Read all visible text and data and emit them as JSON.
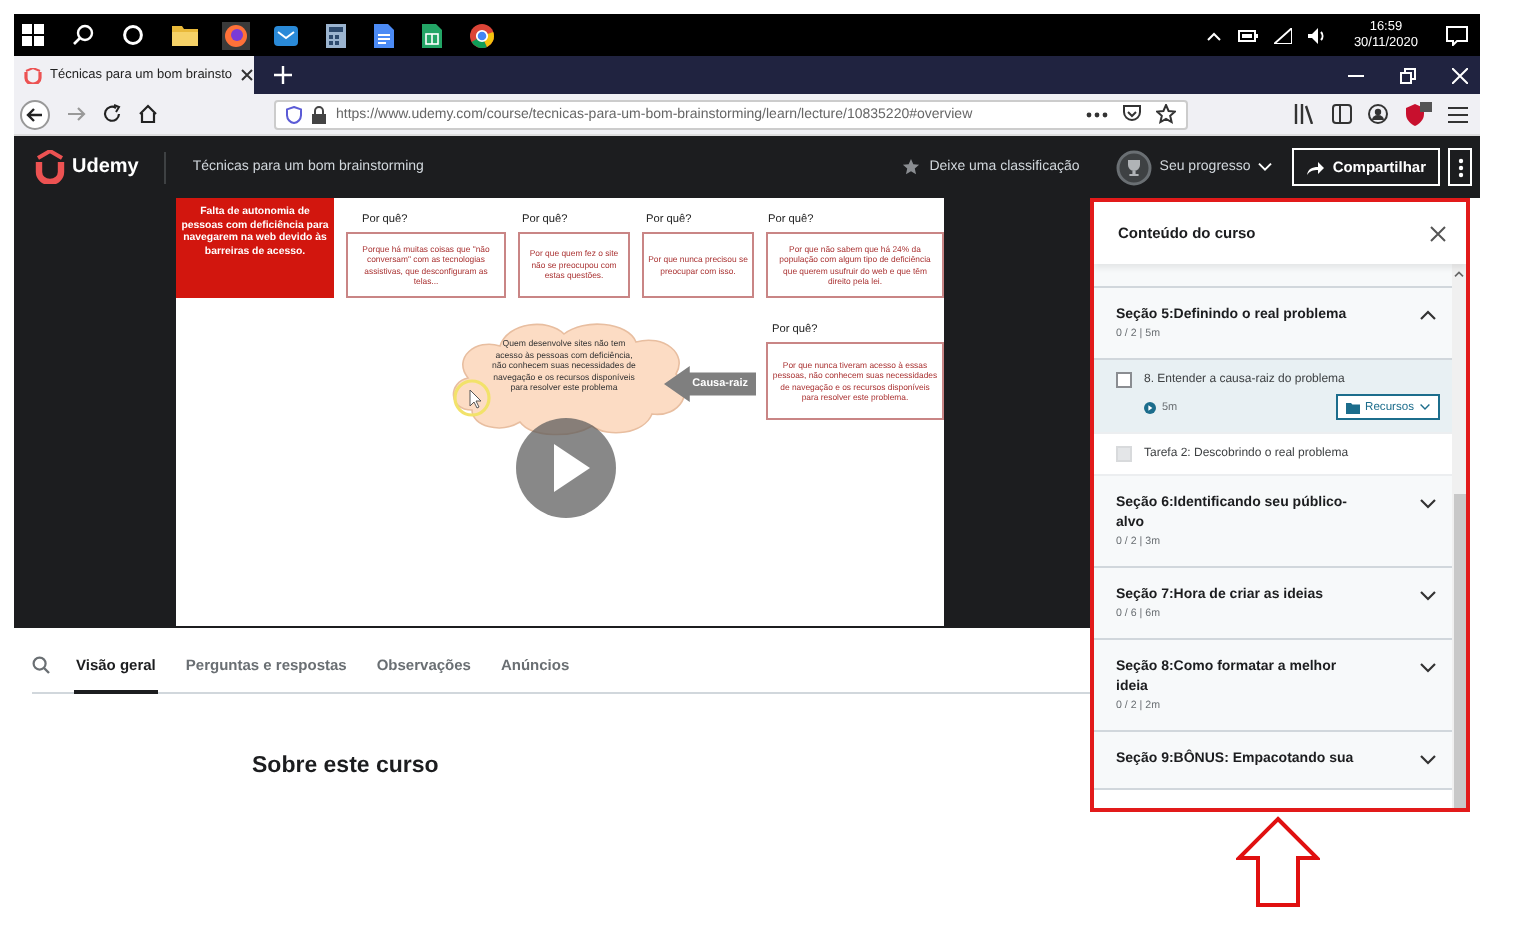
{
  "taskbar": {
    "time": "16:59",
    "date": "30/11/2020"
  },
  "browser": {
    "tab_title": "Técnicas para um bom brainsto",
    "url": "https://www.udemy.com/course/tecnicas-para-um-bom-brainstorming/learn/lecture/10835220#overview"
  },
  "header": {
    "logo": "Udemy",
    "course_title": "Técnicas para um bom brainstorming",
    "rate": "Deixe uma classificação",
    "progress": "Seu progresso",
    "share": "Compartilhar"
  },
  "slide": {
    "problem": "Falta de autonomia de pessoas com deficiência para navegarem na web devido às barreiras de acesso.",
    "whys": [
      {
        "label": "Por quê?",
        "text": "Porque há muitas coisas que \"não conversam\" com as tecnologias assistivas, que desconfiguram as telas..."
      },
      {
        "label": "Por quê?",
        "text": "Por que quem fez o site não se preocupou com estas questões."
      },
      {
        "label": "Por quê?",
        "text": "Por que nunca precisou se preocupar com isso."
      },
      {
        "label": "Por quê?",
        "text": "Por que não sabem que há 24% da população com algum tipo de deficiência que querem usufruir do web e que têm direito pela lei."
      },
      {
        "label": "Por quê?",
        "text": "Por que nunca tiveram acesso à essas pessoas, não conhecem suas necessidades de navegação e os recursos disponíveis para resolver este problema."
      }
    ],
    "root_label": "Causa-raiz",
    "root_cause": "Quem desenvolve sites não tem acesso às pessoas com deficiência, não conhecem suas necessidades de navegação e os recursos disponíveis para resolver este problema"
  },
  "sidebar": {
    "title": "Conteúdo do curso",
    "sections": [
      {
        "title": "Seção 5:Definindo o real problema",
        "meta": "0 / 2 | 5m",
        "expanded": true,
        "items": [
          {
            "kind": "lecture",
            "title": "8. Entender a causa-raiz do problema",
            "duration": "5m",
            "resources": "Recursos",
            "selected": true,
            "checked": false
          },
          {
            "kind": "task",
            "title": "Tarefa 2: Descobrindo o real problema",
            "selected": false,
            "checked": false
          }
        ]
      },
      {
        "title": "Seção 6:Identificando seu público-alvo",
        "meta": "0 / 2 | 3m",
        "expanded": false
      },
      {
        "title": "Seção 7:Hora de criar as ideias",
        "meta": "0 / 6 | 6m",
        "expanded": false
      },
      {
        "title": "Seção 8:Como formatar a melhor ideia",
        "meta": "0 / 2 | 2m",
        "expanded": false
      },
      {
        "title": "Seção 9:BÔNUS: Empacotando sua",
        "expanded": false
      }
    ]
  },
  "content_tabs": [
    {
      "label": "Visão geral",
      "selected": true
    },
    {
      "label": "Perguntas e respostas",
      "selected": false
    },
    {
      "label": "Observações",
      "selected": false
    },
    {
      "label": "Anúncios",
      "selected": false
    }
  ],
  "heading": "Sobre este curso"
}
